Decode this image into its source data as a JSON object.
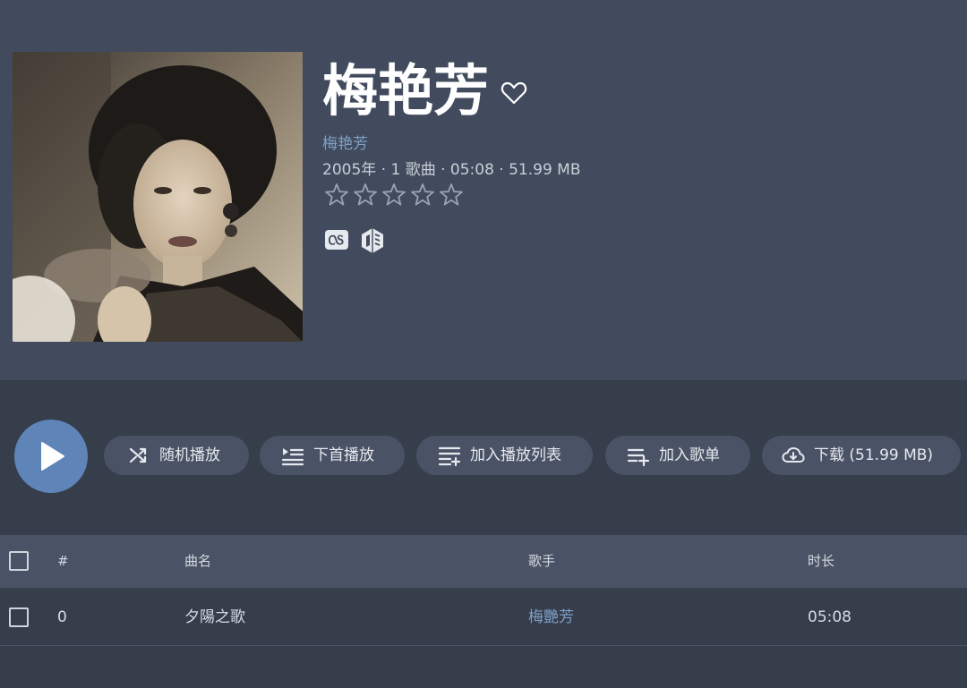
{
  "album": {
    "title": "梅艳芳",
    "artist": "梅艳芳",
    "meta": "2005年 · 1 歌曲 · 05:08 · 51.99 MB",
    "rating": 0,
    "rating_max": 5,
    "favorite": false,
    "external_links": [
      "lastfm-icon",
      "musicbrainz-icon"
    ]
  },
  "actions": {
    "play": "play-icon",
    "shuffle_label": "随机播放",
    "play_next_label": "下首播放",
    "add_to_queue_label": "加入播放列表",
    "add_to_playlist_label": "加入歌单",
    "download_label": "下载 (51.99 MB)"
  },
  "table": {
    "columns": [
      "#",
      "曲名",
      "歌手",
      "时长"
    ],
    "rows": [
      {
        "num": "0",
        "title": "夕陽之歌",
        "artist": "梅艷芳",
        "duration": "05:08"
      }
    ]
  },
  "colors": {
    "header_bg": "#424b5d",
    "page_bg": "#363d4b",
    "accent": "#5e84b8",
    "link": "#7f9fc6",
    "button_bg": "#4a5366"
  }
}
